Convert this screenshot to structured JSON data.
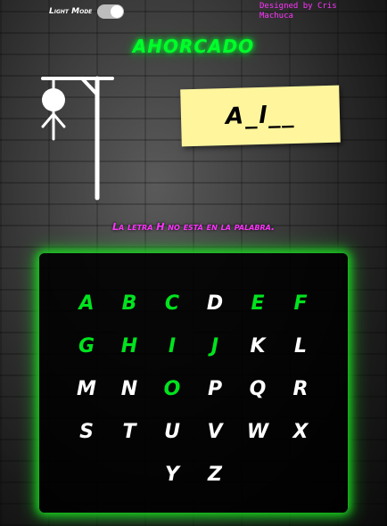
{
  "header": {
    "toggle_label": "Light Mode",
    "credit": "Designed by Cris Machuca"
  },
  "title": "AHORCADO",
  "word": {
    "display": "A_l__"
  },
  "message": "La letra H no está en la palabra.",
  "keyboard": {
    "letters": [
      {
        "char": "A",
        "used": true
      },
      {
        "char": "B",
        "used": true
      },
      {
        "char": "C",
        "used": true
      },
      {
        "char": "D",
        "used": false
      },
      {
        "char": "E",
        "used": true
      },
      {
        "char": "F",
        "used": true
      },
      {
        "char": "G",
        "used": true
      },
      {
        "char": "H",
        "used": true
      },
      {
        "char": "I",
        "used": true
      },
      {
        "char": "J",
        "used": true
      },
      {
        "char": "K",
        "used": false
      },
      {
        "char": "L",
        "used": false
      },
      {
        "char": "M",
        "used": false
      },
      {
        "char": "N",
        "used": false
      },
      {
        "char": "O",
        "used": true
      },
      {
        "char": "P",
        "used": false
      },
      {
        "char": "Q",
        "used": false
      },
      {
        "char": "R",
        "used": false
      },
      {
        "char": "S",
        "used": false
      },
      {
        "char": "T",
        "used": false
      },
      {
        "char": "U",
        "used": false
      },
      {
        "char": "V",
        "used": false
      },
      {
        "char": "W",
        "used": false
      },
      {
        "char": "X",
        "used": false
      },
      {
        "char": "",
        "used": false
      },
      {
        "char": "",
        "used": false
      },
      {
        "char": "Y",
        "used": false
      },
      {
        "char": "Z",
        "used": false
      }
    ]
  },
  "colors": {
    "accent_green": "#00ff2a",
    "used_letter": "#00e41e",
    "message_pink": "#ff33ff",
    "card_yellow": "#fff59d"
  },
  "icons": {
    "hangman": "hangman-figure-icon",
    "toggle": "toggle-switch-icon"
  }
}
